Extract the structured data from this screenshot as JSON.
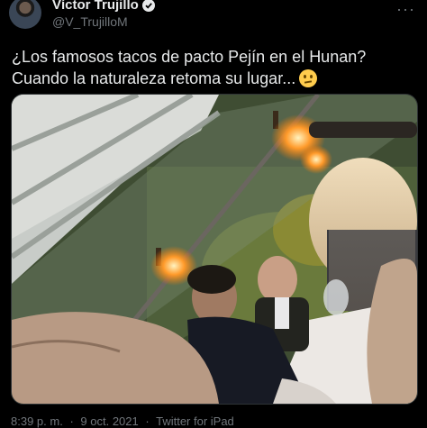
{
  "user": {
    "display_name": "Víctor Trujillo",
    "handle": "@V_TrujilloM",
    "verified": true
  },
  "tweet": {
    "line1": "¿Los famosos tacos de pacto Pejín en el Hunan?",
    "line2": "Cuando la naturaleza retoma su lugar...",
    "emoji": "thinking-face"
  },
  "media": {
    "type": "photo",
    "scene": "restaurant-interior-with-plants"
  },
  "meta": {
    "time": "8:39 p. m.",
    "separator1": "·",
    "date": "9 oct. 2021",
    "separator2": "·",
    "source": "Twitter for iPad"
  },
  "icons": {
    "verified": "verified-badge-icon",
    "more": "more-options-icon"
  },
  "colors": {
    "background": "#000000",
    "text": "#e7e9ea",
    "secondary": "#71767b"
  }
}
